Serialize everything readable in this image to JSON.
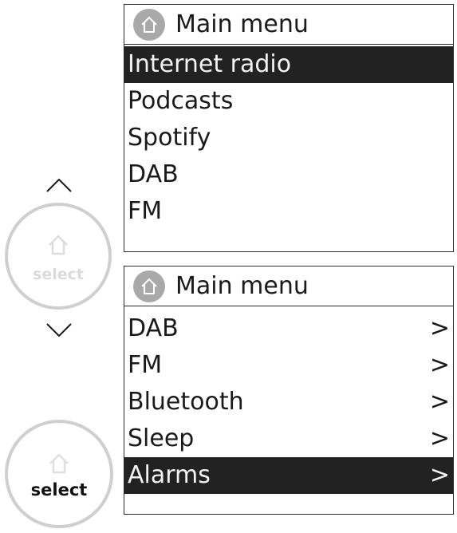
{
  "controls": {
    "knob_inactive_label": "select",
    "knob_active_label": "select",
    "icons": [
      "chevron-up-icon",
      "chevron-down-icon",
      "home-icon"
    ]
  },
  "screens": [
    {
      "title": "Main menu",
      "items": [
        {
          "label": "Internet radio",
          "selected": true
        },
        {
          "label": "Podcasts",
          "selected": false
        },
        {
          "label": "Spotify",
          "selected": false
        },
        {
          "label": "DAB",
          "selected": false
        },
        {
          "label": "FM",
          "selected": false
        }
      ]
    },
    {
      "title": "Main menu",
      "items": [
        {
          "label": "DAB",
          "chevron": ">",
          "selected": false
        },
        {
          "label": "FM",
          "chevron": ">",
          "selected": false
        },
        {
          "label": "Bluetooth",
          "chevron": ">",
          "selected": false
        },
        {
          "label": "Sleep",
          "chevron": ">",
          "selected": false
        },
        {
          "label": "Alarms",
          "chevron": ">",
          "selected": true
        }
      ]
    }
  ],
  "colors": {
    "highlight_bg": "#222222",
    "highlight_text": "#f2f2f2",
    "knob_ring": "#cfcfcf",
    "home_badge": "#a9a9a9"
  }
}
